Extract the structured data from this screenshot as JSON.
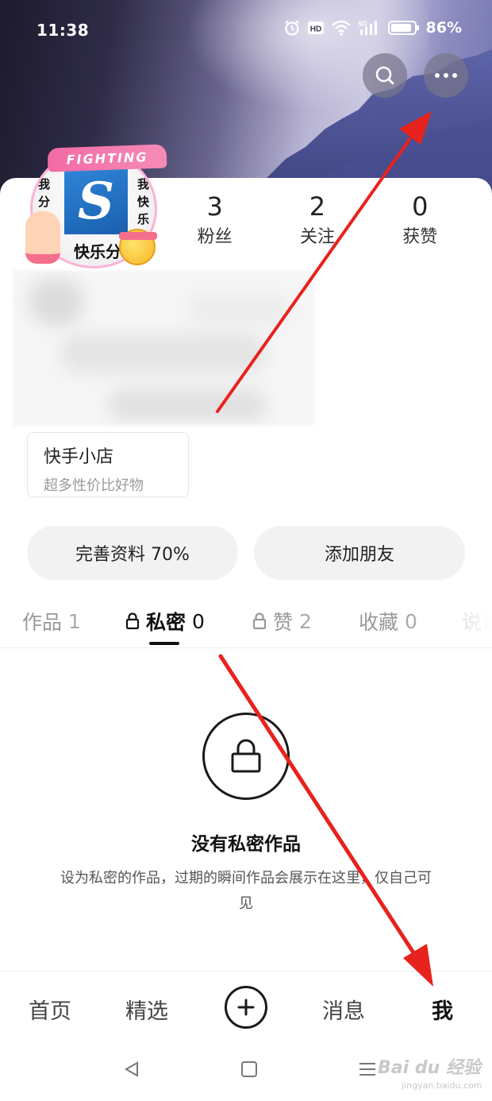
{
  "status_bar": {
    "time": "11:38",
    "battery": "86%",
    "icons": [
      "alarm-icon",
      "hd-icon",
      "wifi-icon",
      "5g-signal-icon",
      "battery-icon"
    ]
  },
  "header": {
    "search_icon": "search-icon",
    "more_icon": "more-icon"
  },
  "avatar": {
    "ribbon_text": "FIGHTING",
    "logo_letter": "S",
    "left_text": "我分",
    "right_text": "我快乐",
    "bottom_text": "快乐分"
  },
  "stats": [
    {
      "value": "3",
      "label": "粉丝"
    },
    {
      "value": "2",
      "label": "关注"
    },
    {
      "value": "0",
      "label": "获赞"
    }
  ],
  "shop": {
    "title": "快手小店",
    "subtitle": "超多性价比好物"
  },
  "actions": {
    "profile_label": "完善资料 70%",
    "add_friend_label": "添加朋友"
  },
  "tabs": [
    {
      "label": "作品",
      "count": "1",
      "locked": false
    },
    {
      "label": "私密",
      "count": "0",
      "locked": true,
      "active": true
    },
    {
      "label": "赞",
      "count": "2",
      "locked": true
    },
    {
      "label": "收藏",
      "count": "0",
      "locked": false
    },
    {
      "label": "说说",
      "count": "",
      "locked": false
    }
  ],
  "empty_state": {
    "title": "没有私密作品",
    "description": "设为私密的作品，过期的瞬间作品会展示在这里，仅自己可见"
  },
  "bottom_nav": {
    "home": "首页",
    "featured": "精选",
    "messages": "消息",
    "me": "我"
  },
  "watermark": {
    "text": "Bai du 经验",
    "sub": "jingyan.baidu.com"
  },
  "colors": {
    "annotation_arrow": "#e8221c",
    "accent_dark": "#111111"
  }
}
